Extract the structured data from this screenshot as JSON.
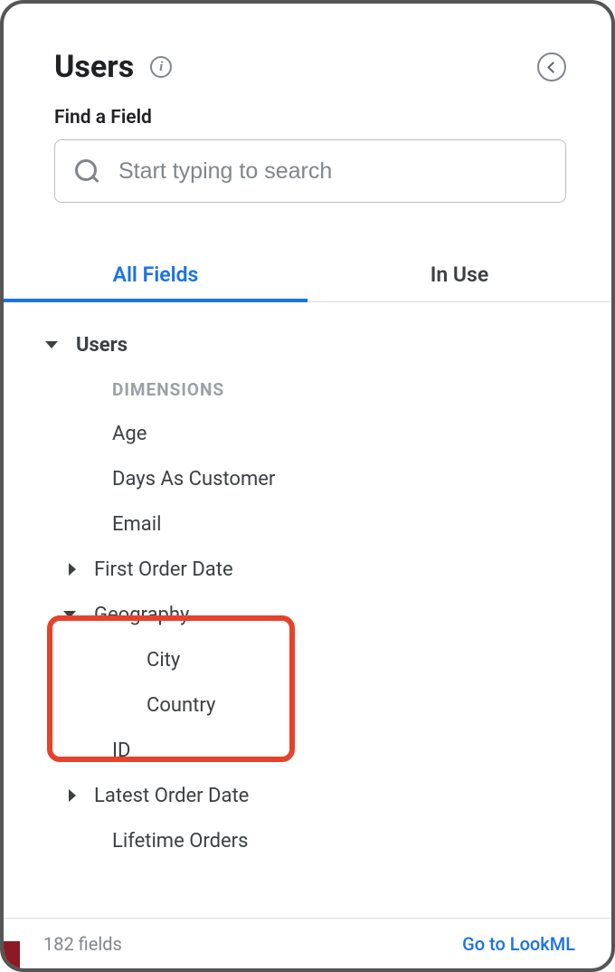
{
  "header": {
    "title": "Users"
  },
  "search": {
    "label": "Find a Field",
    "placeholder": "Start typing to search"
  },
  "tabs": {
    "all_fields": "All Fields",
    "in_use": "In Use"
  },
  "tree": {
    "top": "Users",
    "section_dimensions": "DIMENSIONS",
    "fields": {
      "age": "Age",
      "days_as_customer": "Days As Customer",
      "email": "Email",
      "first_order_date": "First Order Date",
      "geography": "Geography",
      "geo_city": "City",
      "geo_country": "Country",
      "id": "ID",
      "latest_order_date": "Latest Order Date",
      "lifetime_orders": "Lifetime Orders"
    }
  },
  "footer": {
    "count": "182 fields",
    "lookml": "Go to LookML"
  }
}
